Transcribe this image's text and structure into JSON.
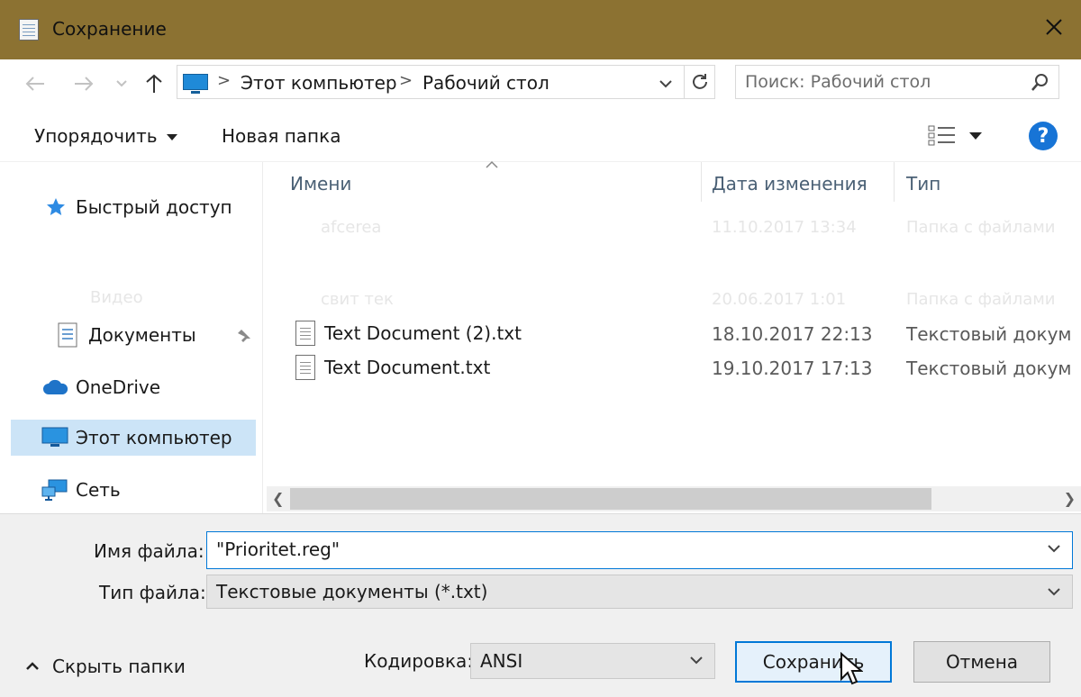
{
  "window": {
    "title": "Сохранение",
    "close_icon": "close-icon"
  },
  "navigation": {
    "back_icon": "arrow-left-icon",
    "forward_icon": "arrow-right-icon",
    "recent_icon": "chevron-down-icon",
    "up_icon": "arrow-up-icon"
  },
  "address": {
    "segments": [
      "Этот компьютер",
      "Рабочий стол"
    ],
    "separator": ">"
  },
  "search": {
    "placeholder": "Поиск: Рабочий стол"
  },
  "toolbar": {
    "organize_label": "Упорядочить",
    "new_folder_label": "Новая папка",
    "help_label": "?"
  },
  "sidebar": {
    "items": [
      {
        "label": "Быстрый доступ",
        "icon": "star-icon"
      },
      {
        "label": "Документы",
        "icon": "document-icon"
      },
      {
        "label": "OneDrive",
        "icon": "cloud-icon"
      },
      {
        "label": "Этот компьютер",
        "icon": "computer-icon"
      },
      {
        "label": "Сеть",
        "icon": "network-icon"
      }
    ]
  },
  "faded": {
    "sidebar_partial": "Видео",
    "row1_name": "afcerea",
    "row1_date": "11.10.2017 13:34",
    "row1_type": "Папка с файлами",
    "row2_name": "свит тек",
    "row2_date": "20.06.2017 1:01",
    "row2_type": "Папка с файлами"
  },
  "files": {
    "columns": [
      "Имени",
      "Дата изменения",
      "Тип"
    ],
    "rows": [
      {
        "name": "Text Document (2).txt",
        "date": "18.10.2017 22:13",
        "type": "Текстовый докум"
      },
      {
        "name": "Text Document.txt",
        "date": "19.10.2017 17:13",
        "type": "Текстовый докум"
      }
    ]
  },
  "form": {
    "filename_label": "Имя файла:",
    "filename_value": "\"Prioritet.reg\"",
    "filetype_label": "Тип файла:",
    "filetype_value": "Текстовые документы (*.txt)",
    "encoding_label": "Кодировка:",
    "encoding_value": "ANSI",
    "save_label": "Сохранить",
    "cancel_label": "Отмена",
    "hide_folders_label": "Скрыть папки"
  }
}
